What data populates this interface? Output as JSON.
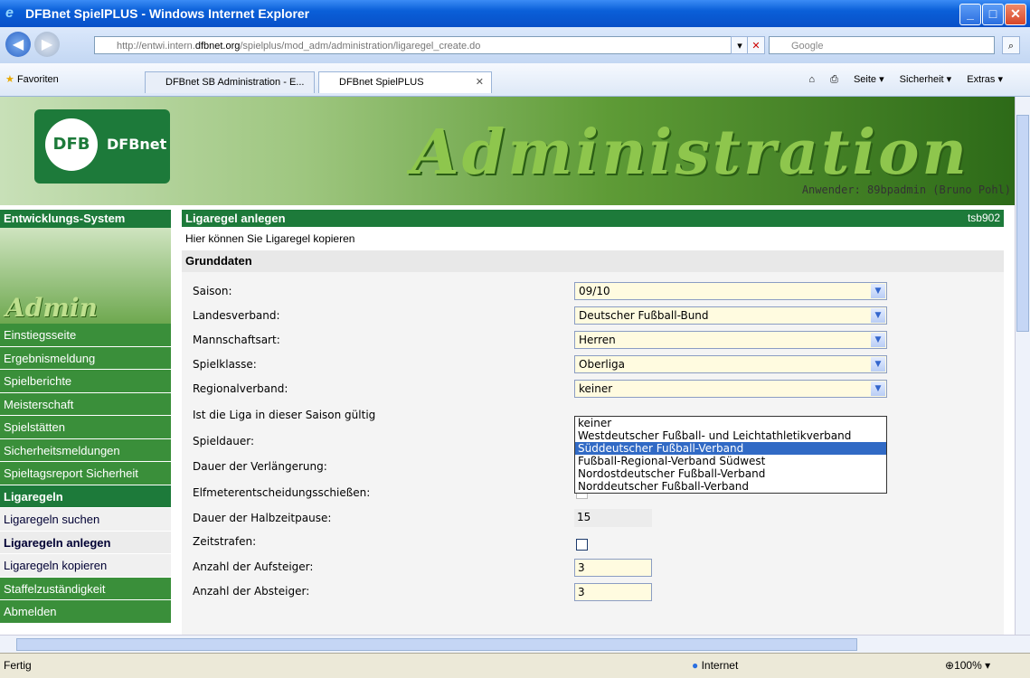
{
  "window": {
    "title": "DFBnet SpielPLUS - Windows Internet Explorer"
  },
  "address": {
    "url_prefix": "http://entwi.intern.",
    "url_domain": "dfbnet.org",
    "url_suffix": "/spielplus/mod_adm/administration/ligaregel_create.do",
    "search_placeholder": "Google"
  },
  "favorites": {
    "label": "Favoriten",
    "tabs": [
      "DFBnet SB Administration - E...",
      "DFBnet SpielPLUS"
    ],
    "commands": [
      "Seite ▾",
      "Sicherheit ▾",
      "Extras ▾"
    ]
  },
  "banner": {
    "logo_text": "DFBnet",
    "title": "Administration",
    "user": "Anwender: 89bpadmin (Bruno Pohl)"
  },
  "sidebar": {
    "header": "Entwicklungs-System",
    "image_text": "Admin",
    "items": [
      {
        "label": "Einstiegsseite",
        "kind": "green"
      },
      {
        "label": "Ergebnismeldung",
        "kind": "green"
      },
      {
        "label": "Spielberichte",
        "kind": "green"
      },
      {
        "label": "Meisterschaft",
        "kind": "green"
      },
      {
        "label": "Spielstätten",
        "kind": "green"
      },
      {
        "label": "Sicherheitsmeldungen",
        "kind": "green"
      },
      {
        "label": "Spieltagsreport Sicherheit",
        "kind": "green"
      },
      {
        "label": "Ligaregeln",
        "kind": "section"
      },
      {
        "label": "Ligaregeln suchen",
        "kind": "sub"
      },
      {
        "label": "Ligaregeln anlegen",
        "kind": "sub active"
      },
      {
        "label": "Ligaregeln kopieren",
        "kind": "sub"
      },
      {
        "label": "Staffelzuständigkeit",
        "kind": "green"
      },
      {
        "label": "Abmelden",
        "kind": "green"
      }
    ]
  },
  "content": {
    "title": "Ligaregel anlegen",
    "code": "tsb902",
    "intro": "Hier können Sie Ligaregel kopieren",
    "section": "Grunddaten",
    "fields": {
      "saison": {
        "label": "Saison:",
        "value": "09/10"
      },
      "landesverband": {
        "label": "Landesverband:",
        "value": "Deutscher Fußball-Bund"
      },
      "mannschaftsart": {
        "label": "Mannschaftsart:",
        "value": "Herren"
      },
      "spielklasse": {
        "label": "Spielklasse:",
        "value": "Oberliga"
      },
      "regionalverband": {
        "label": "Regionalverband:",
        "value": "keiner"
      },
      "gueltig": {
        "label": "Ist die Liga in dieser Saison gültig"
      },
      "spieldauer": {
        "label": "Spieldauer:"
      },
      "verlaengerung": {
        "label": "Dauer der Verlängerung:"
      },
      "elfmeter": {
        "label": "Elfmeterentscheidungsschießen:"
      },
      "halbzeit": {
        "label": "Dauer der Halbzeitpause:",
        "value": "15"
      },
      "zeitstrafen": {
        "label": "Zeitstrafen:"
      },
      "aufsteiger": {
        "label": "Anzahl der Aufsteiger:",
        "value": "3"
      },
      "absteiger": {
        "label": "Anzahl der Absteiger:",
        "value": "3"
      }
    },
    "dropdown_options": [
      "keiner",
      "Westdeutscher Fußball- und Leichtathletikverband",
      "Süddeutscher Fußball-Verband",
      "Fußball-Regional-Verband Südwest",
      "Nordostdeutscher Fußball-Verband",
      "Norddeutscher Fußball-Verband"
    ],
    "dropdown_highlighted": "Süddeutscher Fußball-Verband"
  },
  "status": {
    "left": "Fertig",
    "zone": "Internet",
    "zoom": "100%"
  }
}
